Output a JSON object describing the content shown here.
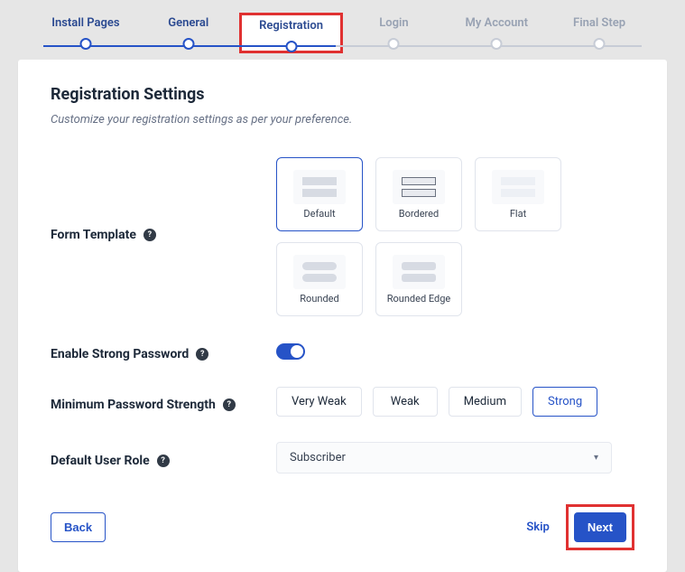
{
  "stepper": {
    "steps": [
      {
        "label": "Install Pages",
        "state": "active"
      },
      {
        "label": "General",
        "state": "active"
      },
      {
        "label": "Registration",
        "state": "current"
      },
      {
        "label": "Login",
        "state": "upcoming"
      },
      {
        "label": "My Account",
        "state": "upcoming"
      },
      {
        "label": "Final Step",
        "state": "upcoming"
      }
    ]
  },
  "page": {
    "title": "Registration Settings",
    "subtitle": "Customize your registration settings as per your preference."
  },
  "form_template": {
    "label": "Form Template",
    "options": [
      "Default",
      "Bordered",
      "Flat",
      "Rounded",
      "Rounded Edge"
    ],
    "selected": "Default"
  },
  "strong_password": {
    "label": "Enable Strong Password",
    "enabled": true
  },
  "password_strength": {
    "label": "Minimum Password Strength",
    "options": [
      "Very Weak",
      "Weak",
      "Medium",
      "Strong"
    ],
    "selected": "Strong"
  },
  "default_role": {
    "label": "Default User Role",
    "value": "Subscriber"
  },
  "footer": {
    "back": "Back",
    "skip": "Skip",
    "next": "Next"
  }
}
